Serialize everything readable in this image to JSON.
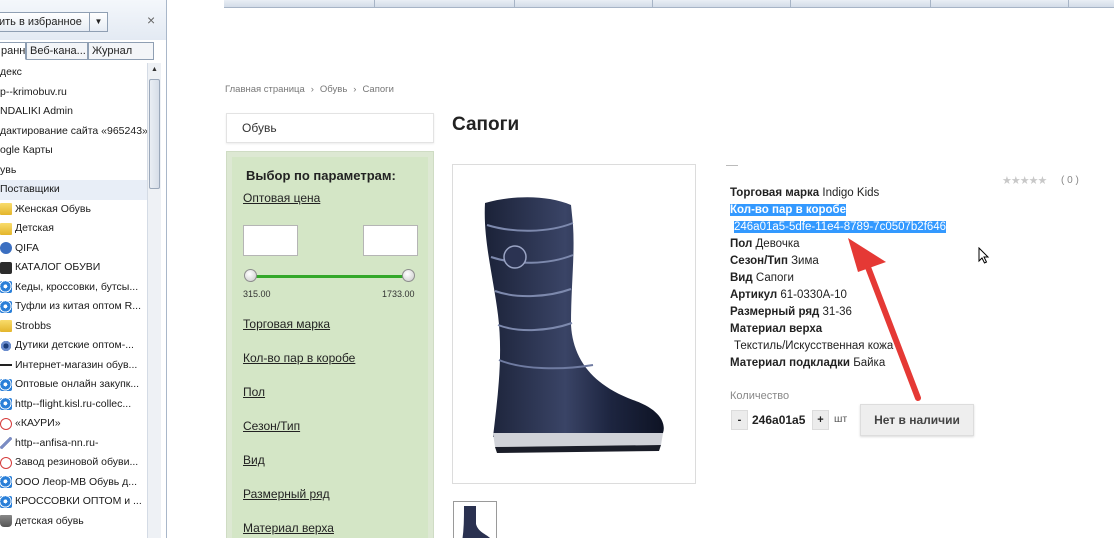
{
  "favorites": {
    "add_button": "ить в избранное",
    "tabs": [
      "ранное",
      "Веб-кана...",
      "Журнал"
    ],
    "items": [
      {
        "label": "декс",
        "icon": "none-icon"
      },
      {
        "label": "p--krimobuv.ru",
        "icon": "none-icon"
      },
      {
        "label": "NDALIKI Admin",
        "icon": "none-icon"
      },
      {
        "label": "дактирование сайта «965243»",
        "icon": "none-icon"
      },
      {
        "label": "ogle Карты",
        "icon": "none-icon"
      },
      {
        "label": "увь",
        "icon": "none-icon"
      },
      {
        "label": "Поставщики",
        "icon": "none-icon"
      },
      {
        "label": "Женская Обувь",
        "icon": "folder-icon"
      },
      {
        "label": "Детская",
        "icon": "folder-icon"
      },
      {
        "label": "QIFA",
        "icon": "globe-icon"
      },
      {
        "label": "КАТАЛОГ ОБУВИ",
        "icon": "site-icon"
      },
      {
        "label": "Кеды, кроссовки, бутсы...",
        "icon": "ie-page-icon"
      },
      {
        "label": "Туфли из китая оптом R...",
        "icon": "ie-page-icon"
      },
      {
        "label": "Strobbs",
        "icon": "folder-icon"
      },
      {
        "label": "Дутики детские оптом-...",
        "icon": "eye-icon"
      },
      {
        "label": "Интернет-магазин обув...",
        "icon": "dash-icon"
      },
      {
        "label": "Оптовые онлайн закупк...",
        "icon": "ie-page-icon"
      },
      {
        "label": "http--flight.kisl.ru-collec...",
        "icon": "ie-page-icon"
      },
      {
        "label": "«КАУРИ»",
        "icon": "red-circle-icon"
      },
      {
        "label": "http--anfisa-nn.ru-",
        "icon": "pencil-icon"
      },
      {
        "label": "Завод резиновой обуви...",
        "icon": "red-circle-icon"
      },
      {
        "label": "ООО Леор-МВ  Обувь д...",
        "icon": "ie-page-icon"
      },
      {
        "label": "КРОССОВКИ ОПТОМ и ...",
        "icon": "ie-page-icon"
      },
      {
        "label": "детская обувь",
        "icon": "cart-icon"
      }
    ],
    "selected_index": 6
  },
  "page": {
    "breadcrumb": [
      "Главная страница",
      "Обувь",
      "Сапоги"
    ],
    "breadcrumb_sep": "›",
    "category_box": "Обувь",
    "title": "Сапоги",
    "filter": {
      "title": "Выбор по параметрам:",
      "price_label": "Оптовая цена",
      "price_min": "315.00",
      "price_max": "1733.00",
      "links": [
        "Торговая марка",
        "Кол-во пар в коробе",
        "Пол",
        "Сезон/Тип",
        "Вид",
        "Размерный ряд",
        "Материал верха"
      ]
    },
    "product": {
      "props": [
        {
          "name": "Торговая марка",
          "value": "Indigo Kids"
        },
        {
          "name": "Кол-во пар в коробе",
          "value": "246a01a5-5dfe-11e4-8789-7c0507b2f646"
        },
        {
          "name": "Пол",
          "value": "Девочка"
        },
        {
          "name": "Сезон/Тип",
          "value": "Зима"
        },
        {
          "name": "Вид",
          "value": "Сапоги"
        },
        {
          "name": "Артикул",
          "value": "61-0330A-10"
        },
        {
          "name": "Размерный ряд",
          "value": "31-36"
        },
        {
          "name": "Материал верха",
          "value": "Текстиль/Искусственная кожа"
        },
        {
          "name": "Материал подкладки",
          "value": "Байка"
        }
      ],
      "rating_stars": "★★★★★",
      "rating_count": "( 0 )",
      "quantity_label": "Количество",
      "quantity_value": "246a01a5",
      "minus": "-",
      "plus": "+",
      "unit": "шт",
      "stock_button": "Нет в наличии"
    }
  },
  "colors": {
    "filter_bg": "#d4e6c6",
    "slider": "#34a82a",
    "selection": "#3399ff",
    "annotation_arrow": "#e53935"
  }
}
